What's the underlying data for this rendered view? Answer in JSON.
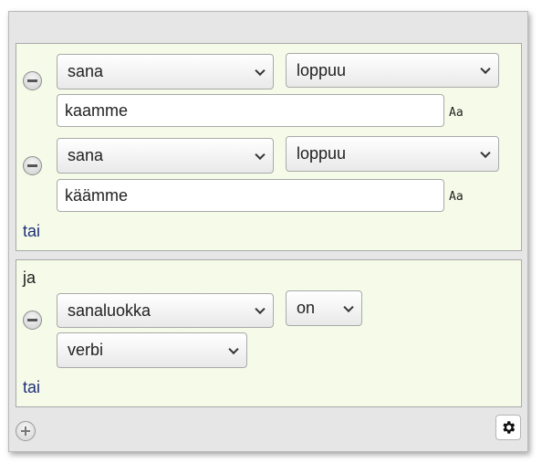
{
  "groups": [
    {
      "conditions": [
        {
          "field": "sana",
          "operator": "loppuu",
          "value": "kaamme",
          "case_toggle": "Aa"
        },
        {
          "field": "sana",
          "operator": "loppuu",
          "value": "käämme",
          "case_toggle": "Aa"
        }
      ],
      "or_label": "tai"
    },
    {
      "connector": "ja",
      "conditions": [
        {
          "field": "sanaluokka",
          "operator": "on",
          "value": "verbi"
        }
      ],
      "or_label": "tai"
    }
  ],
  "icons": {
    "remove": "minus-circle-icon",
    "add": "plus-circle-icon",
    "settings": "gear-icon"
  },
  "colors": {
    "group_background": "#f5fbe8",
    "link_text": "#1f2e7a",
    "panel_background": "#e6e6e6"
  }
}
